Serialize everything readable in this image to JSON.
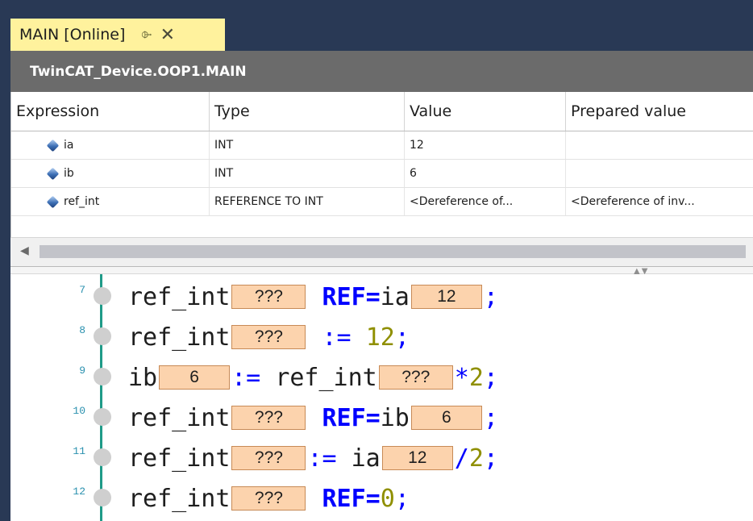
{
  "tab": {
    "title": "MAIN [Online]",
    "pin_glyph": "⌱",
    "close_glyph": "✕"
  },
  "path": "TwinCAT_Device.OOP1.MAIN",
  "watch": {
    "columns": [
      "Expression",
      "Type",
      "Value",
      "Prepared value"
    ],
    "rows": [
      {
        "expression": "ia",
        "type": "INT",
        "value": "12",
        "prepared": ""
      },
      {
        "expression": "ib",
        "type": "INT",
        "value": "6",
        "prepared": ""
      },
      {
        "expression": "ref_int",
        "type": "REFERENCE TO INT",
        "value": "<Dereference of...",
        "prepared": "<Dereference of inv..."
      }
    ]
  },
  "scroll": {
    "left_arrow": "◀",
    "grip": "▲▼"
  },
  "code": {
    "lines": [
      {
        "num": "7",
        "parts": [
          [
            "id",
            "ref_int"
          ],
          [
            "val",
            "???"
          ],
          [
            "sp",
            " "
          ],
          [
            "kw",
            "REF="
          ],
          [
            "id",
            "ia"
          ],
          [
            "val",
            "12"
          ],
          [
            "op",
            ";"
          ]
        ]
      },
      {
        "num": "8",
        "parts": [
          [
            "id",
            "ref_int"
          ],
          [
            "val",
            "???"
          ],
          [
            "sp",
            " "
          ],
          [
            "op",
            ":= "
          ],
          [
            "num",
            "12"
          ],
          [
            "op",
            ";"
          ]
        ]
      },
      {
        "num": "9",
        "parts": [
          [
            "id",
            "ib"
          ],
          [
            "val",
            "6"
          ],
          [
            "op",
            ":= "
          ],
          [
            "id",
            "ref_int"
          ],
          [
            "val",
            "???"
          ],
          [
            "op",
            "*"
          ],
          [
            "num",
            "2"
          ],
          [
            "op",
            ";"
          ]
        ]
      },
      {
        "num": "10",
        "parts": [
          [
            "id",
            "ref_int"
          ],
          [
            "val",
            "???"
          ],
          [
            "sp",
            " "
          ],
          [
            "kw",
            "REF="
          ],
          [
            "id",
            "ib"
          ],
          [
            "val",
            "6"
          ],
          [
            "op",
            ";"
          ]
        ]
      },
      {
        "num": "11",
        "parts": [
          [
            "id",
            "ref_int"
          ],
          [
            "val",
            "???"
          ],
          [
            "op",
            ":= "
          ],
          [
            "id",
            "ia"
          ],
          [
            "val",
            "12"
          ],
          [
            "op",
            "/"
          ],
          [
            "num",
            "2"
          ],
          [
            "op",
            ";"
          ]
        ]
      },
      {
        "num": "12",
        "parts": [
          [
            "id",
            "ref_int"
          ],
          [
            "val",
            "???"
          ],
          [
            "sp",
            " "
          ],
          [
            "kw",
            "REF="
          ],
          [
            "num",
            "0"
          ],
          [
            "op",
            ";"
          ]
        ]
      }
    ]
  },
  "colors": {
    "tabbar": "#293955",
    "tab": "#fff29d",
    "path": "#6b6b6b",
    "inline_value": "#fcd3ad",
    "keyword": "#0000ff",
    "number": "#8f8f00",
    "gutter": "#1f9b88"
  }
}
